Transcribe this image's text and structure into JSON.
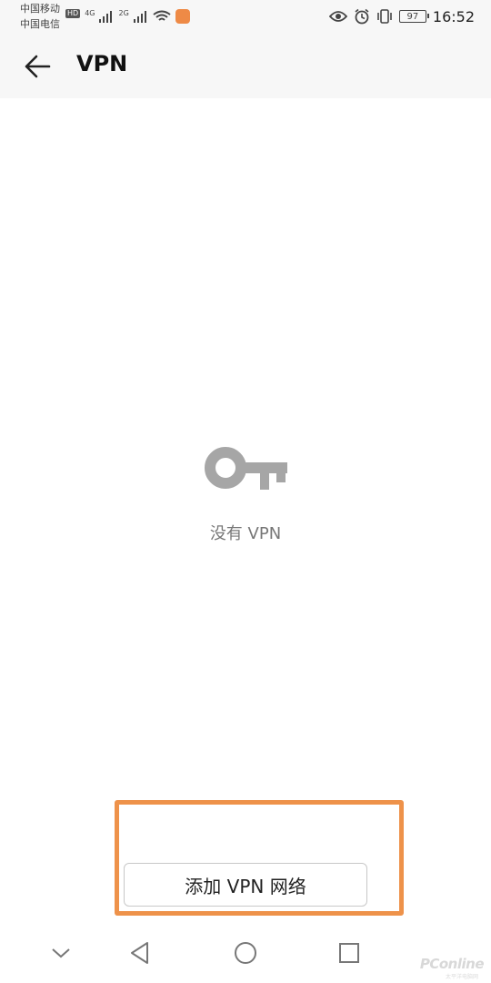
{
  "status_bar": {
    "carrier_1": "中国移动",
    "carrier_2": "中国电信",
    "hd_badge": "HD",
    "network_1": "4G",
    "network_2": "2G",
    "battery": "97",
    "time": "16:52",
    "icons": [
      "signal-icon",
      "wifi-icon",
      "app-notification-icon",
      "eye-icon",
      "alarm-icon",
      "vibrate-icon",
      "battery-icon"
    ]
  },
  "app_bar": {
    "title": "VPN",
    "back_icon": "back-arrow-icon"
  },
  "empty_state": {
    "icon": "key-icon",
    "text": "没有 VPN"
  },
  "actions": {
    "add_vpn_label": "添加 VPN 网络",
    "highlight_color": "#ee924a"
  },
  "navigation_bar": {
    "icons": [
      "collapse-icon",
      "back-icon",
      "home-icon",
      "recents-icon"
    ]
  },
  "watermark": {
    "brand": "PConline",
    "sub": "太平洋电脑网"
  }
}
